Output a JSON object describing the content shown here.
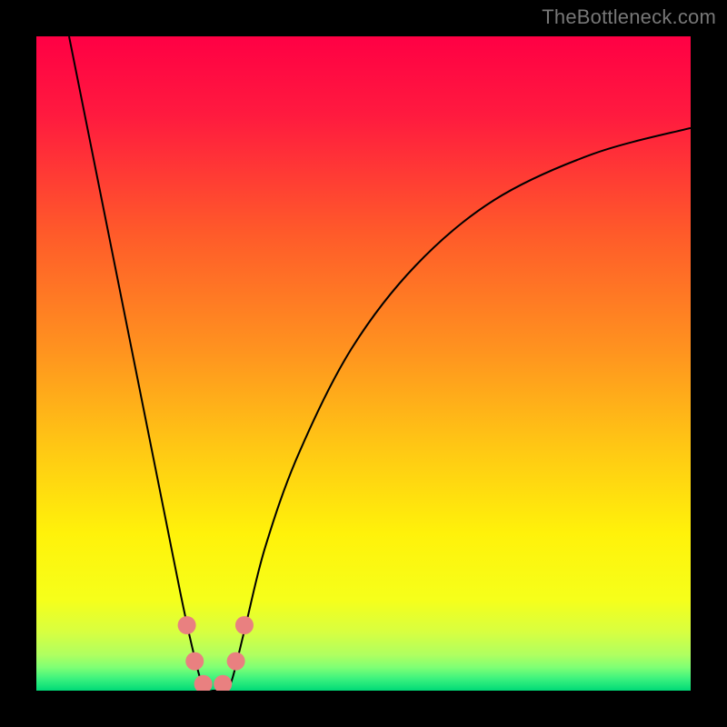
{
  "watermark": "TheBottleneck.com",
  "chart_data": {
    "type": "line",
    "title": "",
    "xlabel": "",
    "ylabel": "",
    "xlim": [
      0,
      100
    ],
    "ylim": [
      0,
      100
    ],
    "grid": false,
    "legend": false,
    "series": [
      {
        "name": "left-curve",
        "x": [
          5,
          10,
          15,
          18,
          20,
          22,
          23.5,
          25,
          26,
          27,
          28
        ],
        "y": [
          100,
          75,
          50,
          35,
          25,
          15,
          8,
          2,
          0,
          0,
          0
        ]
      },
      {
        "name": "right-curve",
        "x": [
          28,
          29,
          30,
          32,
          35,
          40,
          48,
          58,
          70,
          85,
          100
        ],
        "y": [
          0,
          0,
          2,
          10,
          22,
          36,
          52,
          65,
          75,
          82,
          86
        ]
      }
    ],
    "markers": [
      {
        "name": "marker-left-1",
        "x": 23.0,
        "y": 10.0
      },
      {
        "name": "marker-left-2",
        "x": 24.2,
        "y": 4.5
      },
      {
        "name": "marker-bottom-1",
        "x": 25.5,
        "y": 1.0
      },
      {
        "name": "marker-bottom-2",
        "x": 28.5,
        "y": 1.0
      },
      {
        "name": "marker-right-1",
        "x": 30.5,
        "y": 4.5
      },
      {
        "name": "marker-right-2",
        "x": 31.8,
        "y": 10.0
      }
    ],
    "gradient_stops": [
      {
        "offset": 0.0,
        "color": "#ff0044"
      },
      {
        "offset": 0.12,
        "color": "#ff1a3f"
      },
      {
        "offset": 0.3,
        "color": "#ff5a2a"
      },
      {
        "offset": 0.48,
        "color": "#ff931f"
      },
      {
        "offset": 0.63,
        "color": "#ffc814"
      },
      {
        "offset": 0.76,
        "color": "#fff20a"
      },
      {
        "offset": 0.86,
        "color": "#f6ff1a"
      },
      {
        "offset": 0.91,
        "color": "#d8ff40"
      },
      {
        "offset": 0.945,
        "color": "#b0ff60"
      },
      {
        "offset": 0.965,
        "color": "#7dff75"
      },
      {
        "offset": 0.982,
        "color": "#3bf27e"
      },
      {
        "offset": 1.0,
        "color": "#00d977"
      }
    ],
    "curve_color": "#000000",
    "marker_color": "#e98080",
    "marker_radius": 10
  }
}
